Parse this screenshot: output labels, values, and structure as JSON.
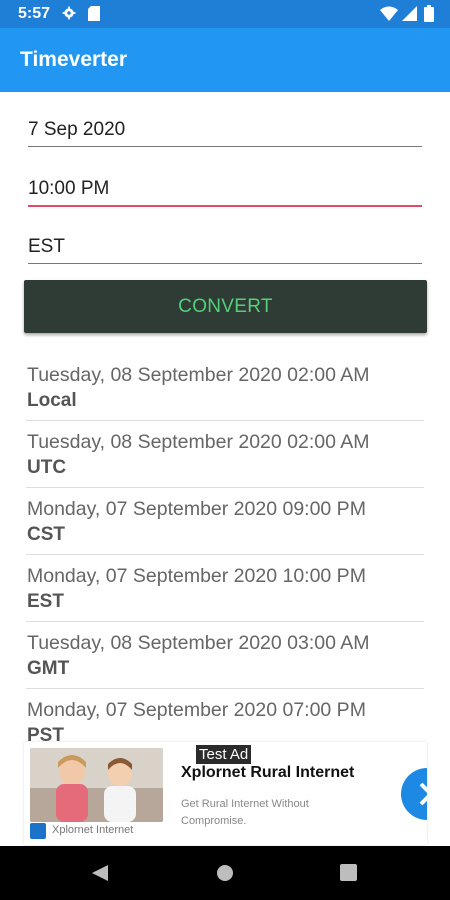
{
  "status_bar": {
    "time": "5:57"
  },
  "app_bar": {
    "title": "Timeverter"
  },
  "form": {
    "date_value": "7 Sep 2020",
    "time_value": "10:00 PM",
    "zone_value": "EST",
    "convert_label": "CONVERT"
  },
  "results": [
    {
      "datetime": "Tuesday, 08 September 2020 02:00 AM",
      "zone": "Local"
    },
    {
      "datetime": "Tuesday, 08 September 2020 02:00 AM",
      "zone": "UTC"
    },
    {
      "datetime": "Monday, 07 September 2020 09:00 PM",
      "zone": "CST"
    },
    {
      "datetime": "Monday, 07 September 2020 10:00 PM",
      "zone": "EST"
    },
    {
      "datetime": "Tuesday, 08 September 2020 03:00 AM",
      "zone": "GMT"
    },
    {
      "datetime": "Monday, 07 September 2020 07:00 PM",
      "zone": "PST"
    }
  ],
  "ad": {
    "badge": "Test Ad",
    "headline": "Xplornet Rural Internet",
    "body": "Get Rural Internet Without Compromise.",
    "brand": "Xplornet Internet"
  },
  "colors": {
    "status_bar": "#1f7fd6",
    "app_bar": "#2196f3",
    "button_bg": "#2f3b35",
    "button_text": "#53d07a",
    "focus_underline": "#e2486c"
  }
}
